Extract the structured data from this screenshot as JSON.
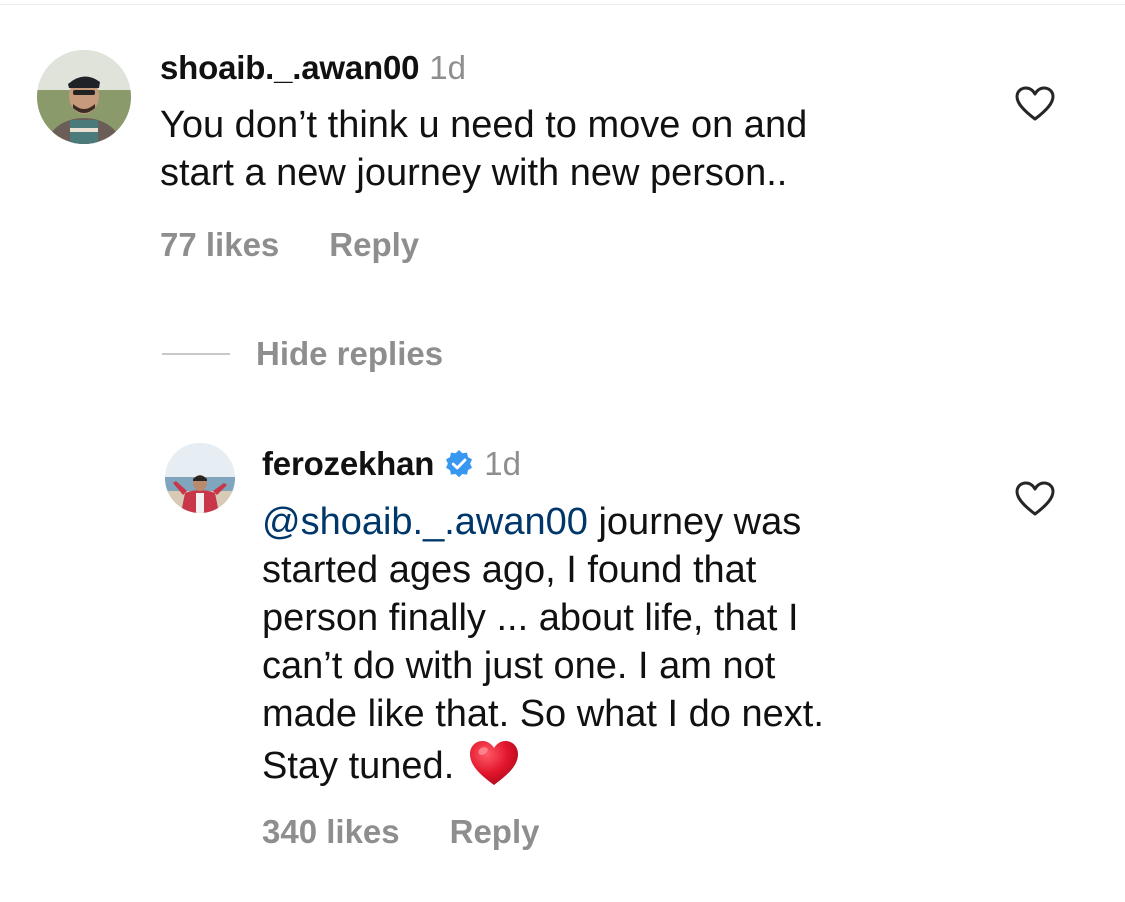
{
  "comment": {
    "username": "shoaib._.awan00",
    "time": "1d",
    "text": "You don’t think u need to move on and\nstart a new journey with new person..",
    "likes": "77 likes",
    "reply_label": "Reply",
    "like_icon": "heart-outline-icon"
  },
  "hide_replies_label": "Hide replies",
  "reply": {
    "username": "ferozekhan",
    "verified_icon": "verified-badge-icon",
    "time": "1d",
    "mention": "@shoaib._.awan00",
    "text": " journey was\nstarted ages ago, I found that\nperson finally ... about life, that I\ncan’t do with just one. I am not\nmade like that. So what I do next.\nStay tuned.",
    "emoji": "red-heart-emoji",
    "likes": "340 likes",
    "reply_label": "Reply",
    "like_icon": "heart-outline-icon"
  },
  "colors": {
    "text": "#111111",
    "secondary": "#8e8e8e",
    "mention": "#00376b",
    "verified": "#3897f0",
    "heart_emoji": "#e0142a"
  }
}
